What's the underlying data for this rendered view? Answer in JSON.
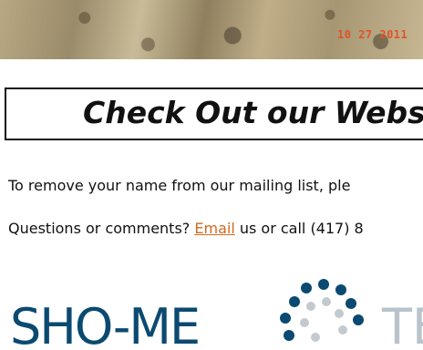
{
  "photo": {
    "date_stamp": "10 27 2011"
  },
  "headline": {
    "text": "Check Out our Websit"
  },
  "unsubscribe_line": {
    "text": "To remove your name from our mailing list, ple"
  },
  "contact_line": {
    "prefix": "Questions or comments? ",
    "email_link": "Email",
    "suffix": " us or call (417) 8"
  },
  "logo": {
    "wordmark": "SHO-ME",
    "wordmark_tail": "TE",
    "colors": {
      "primary": "#0b4a70",
      "dots_dark": "#0b4a70",
      "dots_light": "#c4c9ce"
    }
  },
  "colors": {
    "link": "#d2691e",
    "text": "#111111",
    "background": "#ffffff"
  }
}
